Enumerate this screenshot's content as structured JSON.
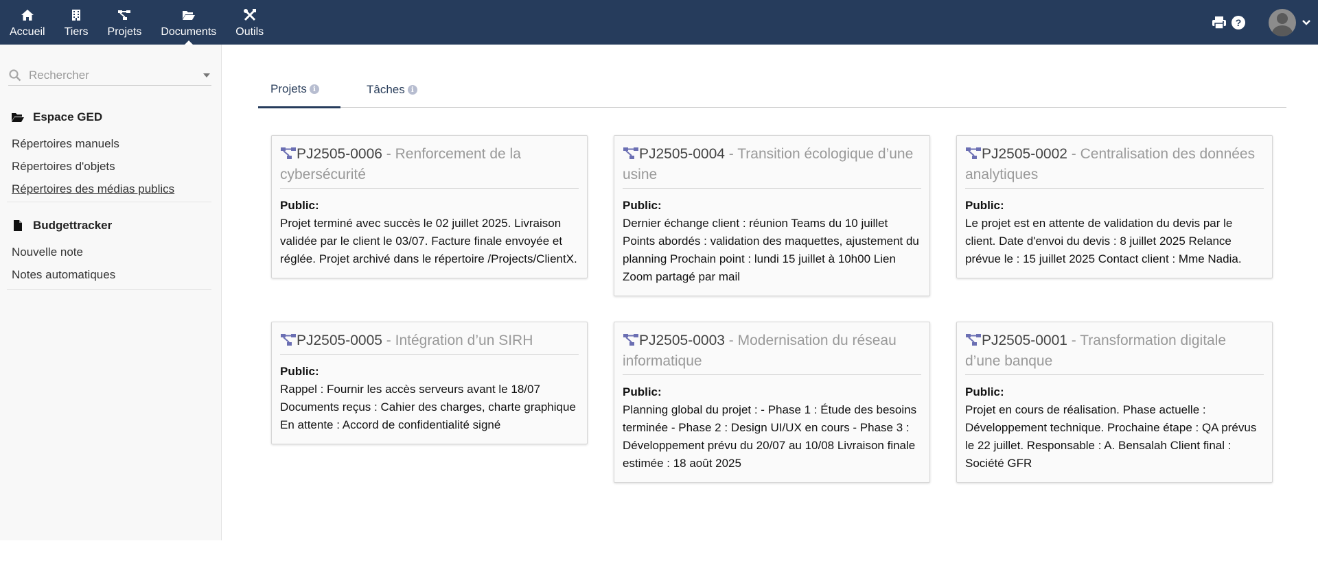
{
  "topbar": {
    "menu": [
      {
        "label": "Accueil",
        "icon": "home-icon"
      },
      {
        "label": "Tiers",
        "icon": "building-icon"
      },
      {
        "label": "Projets",
        "icon": "project-icon"
      },
      {
        "label": "Documents",
        "icon": "folder-open-icon"
      },
      {
        "label": "Outils",
        "icon": "tools-icon"
      }
    ],
    "active_menu": "Documents",
    "right_icons": [
      "print-icon",
      "help-icon",
      "avatar",
      "chevron-down-icon"
    ]
  },
  "sidebar": {
    "search_placeholder": "Rechercher",
    "sections": [
      {
        "title": "Espace GED",
        "icon": "folder-open-icon",
        "links": [
          "Répertoires manuels",
          "Répertoires d'objets",
          "Répertoires des médias publics"
        ]
      },
      {
        "title": "Budgettracker",
        "icon": "file-icon",
        "links": [
          "Nouvelle note",
          "Notes automatiques"
        ]
      }
    ]
  },
  "tabs": [
    {
      "label": "Projets",
      "active": true
    },
    {
      "label": "Tâches",
      "active": false
    }
  ],
  "cards": [
    {
      "ref": "PJ2505-0006",
      "sep": " - ",
      "title": "Renforcement de la cybersécurité",
      "label": "Public:",
      "body": "Projet terminé avec succès le 02 juillet 2025. Livraison validée par le client le 03/07. Facture finale envoyée et réglée. Projet archivé dans le répertoire /Projects/ClientX."
    },
    {
      "ref": "PJ2505-0004",
      "sep": " - ",
      "title": "Transition écologique d’une usine",
      "label": "Public:",
      "body": "Dernier échange client : réunion Teams du 10 juillet Points abordés : validation des maquettes, ajustement du planning Prochain point : lundi 15 juillet à 10h00 Lien Zoom partagé par mail"
    },
    {
      "ref": "PJ2505-0002",
      "sep": " - ",
      "title": "Centralisation des données analytiques",
      "label": "Public:",
      "body": "Le projet est en attente de validation du devis par le client. Date d'envoi du devis : 8 juillet 2025 Relance prévue le : 15 juillet 2025 Contact client : Mme Nadia."
    },
    {
      "ref": "PJ2505-0005",
      "sep": " - ",
      "title": "Intégration d’un SIRH",
      "label": "Public:",
      "body": "Rappel : Fournir les accès serveurs avant le 18/07 Documents reçus : Cahier des charges, charte graphique En attente : Accord de confidentialité signé"
    },
    {
      "ref": "PJ2505-0003",
      "sep": " - ",
      "title": "Modernisation du réseau informatique",
      "label": "Public:",
      "body": "Planning global du projet : - Phase 1 : Étude des besoins terminée - Phase 2 : Design UI/UX en cours - Phase 3 : Développement prévu du 20/07 au 10/08 Livraison finale estimée : 18 août 2025"
    },
    {
      "ref": "PJ2505-0001",
      "sep": " - ",
      "title": "Transformation digitale d’une banque",
      "label": "Public:",
      "body": "Projet en cours de réalisation. Phase actuelle : Développement technique. Prochaine étape : QA prévus le 22 juillet. Responsable : A. Bensalah Client final : Société GFR"
    }
  ],
  "colors": {
    "topbar": "#263c5c",
    "project_icon": "#6b6fb3",
    "title_muted": "#999999"
  }
}
